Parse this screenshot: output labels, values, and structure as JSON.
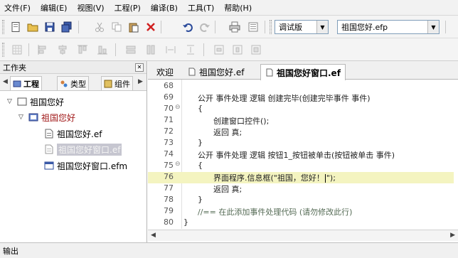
{
  "menubar": {
    "items": [
      "文件(F)",
      "编辑(E)",
      "视图(V)",
      "工程(P)",
      "编译(B)",
      "工具(T)",
      "帮助(H)"
    ]
  },
  "toolbar": {
    "build_mode": "调试版",
    "project_file": "祖国您好.efp"
  },
  "workspace": {
    "title": "工作夹",
    "tabs": [
      "工程",
      "类型",
      "组件"
    ],
    "active_tab": "工程",
    "tree": {
      "root": "祖国您好",
      "project": "祖国您好",
      "files": [
        "祖国您好.ef",
        "祖国您好窗口.ef",
        "祖国您好窗口.efm"
      ]
    }
  },
  "editor": {
    "tabs": [
      "欢迎",
      "祖国您好.ef",
      "祖国您好窗口.ef"
    ],
    "active_tab": "祖国您好窗口.ef",
    "lines": [
      {
        "num": "68",
        "text": ""
      },
      {
        "num": "69",
        "text": "公开 事件处理 逻辑 创建完毕(创建完毕事件 事件)"
      },
      {
        "num": "70",
        "text": "{"
      },
      {
        "num": "71",
        "text": "创建窗口控件();"
      },
      {
        "num": "72",
        "text": "返回 真;"
      },
      {
        "num": "73",
        "text": "}"
      },
      {
        "num": "74",
        "text": "公开 事件处理 逻辑 按钮1_按钮被单击(按钮被单击 事件)"
      },
      {
        "num": "75",
        "text": "{"
      },
      {
        "num": "76",
        "text_before": "界面程序.信息框(\"祖国，您好！",
        "text_after": "\");"
      },
      {
        "num": "77",
        "text": "返回 真;"
      },
      {
        "num": "78",
        "text": "}"
      },
      {
        "num": "79",
        "text": "//== 在此添加事件处理代码 (请勿修改此行)"
      },
      {
        "num": "80",
        "text": "}"
      }
    ]
  },
  "output": {
    "title": "输出"
  }
}
